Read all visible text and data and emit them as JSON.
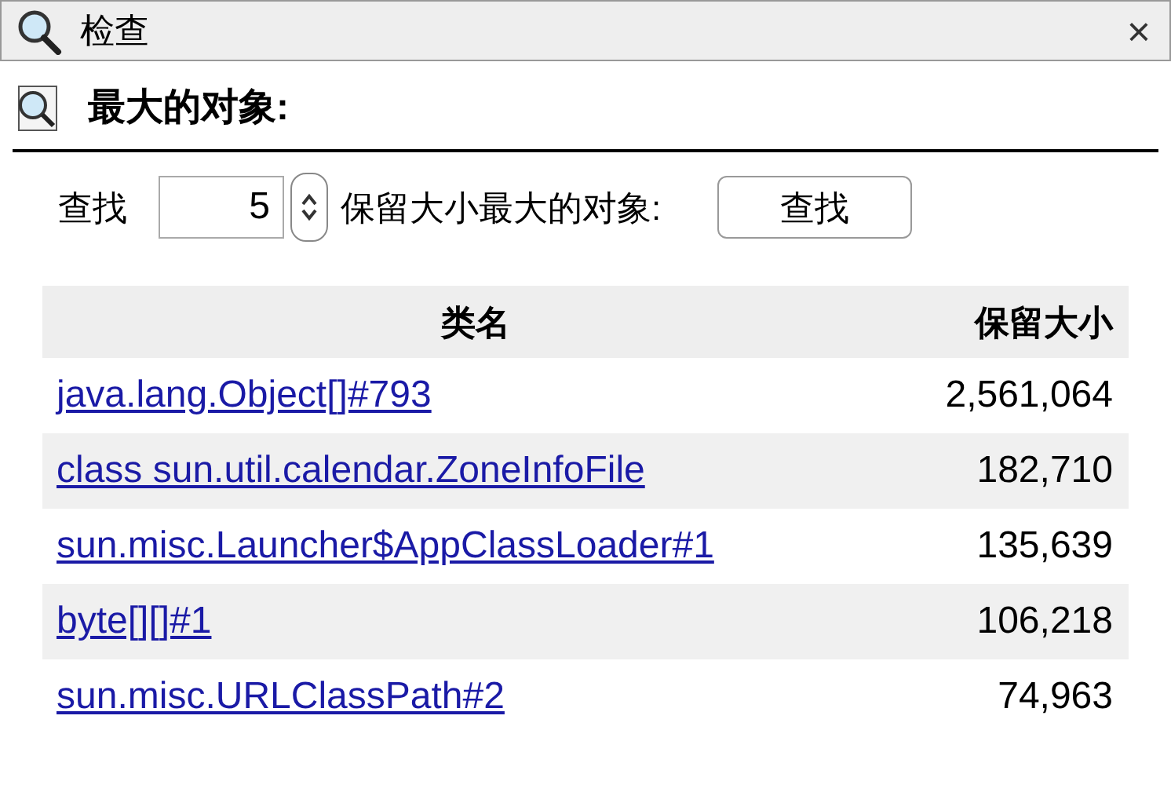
{
  "window": {
    "title": "检查",
    "close": "×"
  },
  "section": {
    "title": "最大的对象:"
  },
  "controls": {
    "find_label": "查找",
    "count": "5",
    "suffix": "保留大小最大的对象:",
    "button": "查找"
  },
  "table": {
    "columns": [
      "类名",
      "保留大小"
    ],
    "rows": [
      {
        "name": "java.lang.Object[]#793",
        "size": "2,561,064"
      },
      {
        "name": "class sun.util.calendar.ZoneInfoFile",
        "size": "182,710"
      },
      {
        "name": "sun.misc.Launcher$AppClassLoader#1",
        "size": "135,639"
      },
      {
        "name": "byte[][]#1",
        "size": "106,218"
      },
      {
        "name": "sun.misc.URLClassPath#2",
        "size": "74,963"
      }
    ]
  }
}
